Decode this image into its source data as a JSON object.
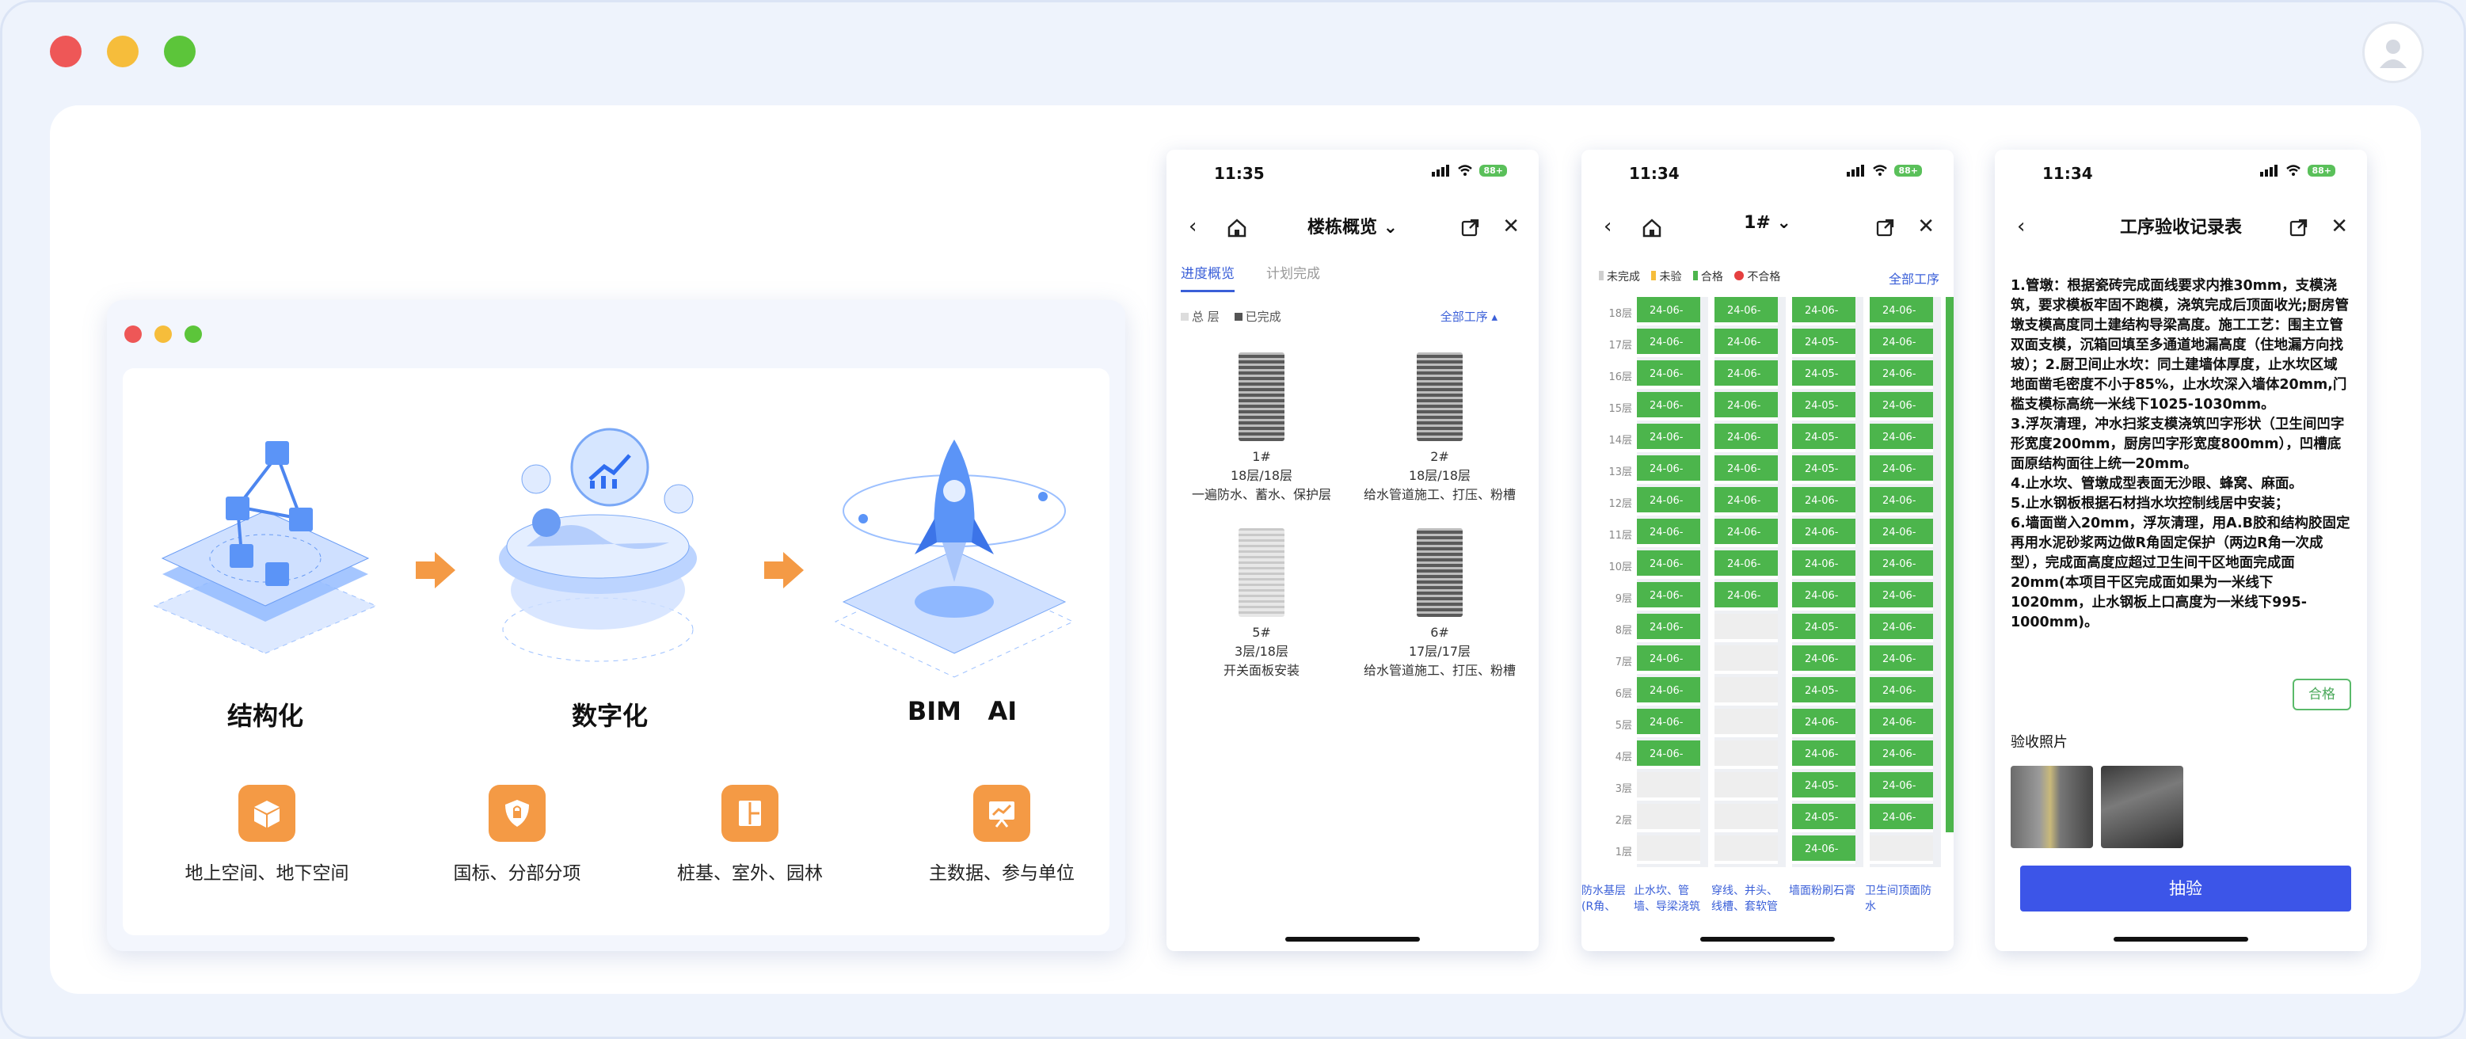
{
  "window": {
    "controls": {
      "close": "#ee5757",
      "minimize": "#f6bd3b",
      "maximize": "#5cc53a"
    },
    "avatar_icon": "user-icon"
  },
  "mock_window": {
    "stages": [
      {
        "title": "结构化",
        "icon": "network-cube-icon"
      },
      {
        "title": "数字化",
        "icon": "digital-chart-icon"
      },
      {
        "title": "BIM   AI",
        "icon": "rocket-icon"
      }
    ],
    "features": [
      {
        "label": "地上空间、地下空间",
        "icon": "box-icon"
      },
      {
        "label": "国标、分部分项",
        "icon": "shield-icon"
      },
      {
        "label": "桩基、室外、园林",
        "icon": "layout-icon"
      },
      {
        "label": "主数据、参与单位",
        "icon": "presentation-icon"
      }
    ],
    "accent": "#f49a45"
  },
  "phone1": {
    "time": "11:35",
    "battery": "88+",
    "title": "楼栋概览 ⌄",
    "tabs": [
      "进度概览",
      "计划完成"
    ],
    "legend": {
      "total": "总 层",
      "done": "已完成",
      "filter": "全部工序 ▴"
    },
    "buildings": [
      {
        "name": "1#",
        "floors": "18层/18层",
        "process": "一遍防水、蓄水、保护层"
      },
      {
        "name": "2#",
        "floors": "18层/18层",
        "process": "给水管道施工、打压、粉槽"
      },
      {
        "name": "5#",
        "floors": "3层/18层",
        "process": "开关面板安装"
      },
      {
        "name": "6#",
        "floors": "17层/17层",
        "process": "给水管道施工、打压、粉槽"
      }
    ]
  },
  "phone2": {
    "time": "11:34",
    "battery": "88+",
    "title": "1# ⌄",
    "legend": [
      "未完成",
      "未验",
      "合格",
      "不合格"
    ],
    "legend_colors": [
      "#cfcfcf",
      "#f6bd3b",
      "#4cb54c",
      "#e54040"
    ],
    "filter": "全部工序",
    "floors": [
      "18层",
      "17层",
      "16层",
      "15层",
      "14层",
      "13层",
      "12层",
      "11层",
      "10层",
      "9层",
      "8层",
      "7层",
      "6层",
      "5层",
      "4层",
      "3层",
      "2层",
      "1层"
    ],
    "columns": [
      {
        "label": "防水基层\n(R角、",
        "label2": "(R角、墙根)"
      },
      {
        "label": "止水坎、管",
        "label2": "墙、导梁浇筑"
      },
      {
        "label": "穿线、并头、",
        "label2": "线槽、套软管"
      },
      {
        "label": "墙面粉刷石膏",
        "label2": ""
      },
      {
        "label": "卫生间顶面防",
        "label2": "水"
      }
    ],
    "cells": {
      "c1": [
        "24-06-",
        "24-06-",
        "24-06-",
        "24-06-",
        "24-06-",
        "24-06-",
        "24-06-",
        "24-06-",
        "24-06-",
        "24-06-",
        "24-06-",
        "24-06-",
        "24-06-",
        "24-06-",
        "24-06-"
      ],
      "c2": [
        "24-06-",
        "24-06-",
        "24-06-",
        "24-06-",
        "24-06-",
        "24-06-",
        "24-06-",
        "24-06-",
        "24-06-",
        "24-06-"
      ],
      "c3": [
        "24-06-",
        "24-05-",
        "24-05-",
        "24-05-",
        "24-05-",
        "24-05-",
        "24-06-",
        "24-06-",
        "24-06-",
        "24-06-",
        "24-05-",
        "24-06-",
        "24-05-",
        "24-06-",
        "24-06-",
        "24-05-",
        "24-05-",
        "24-06-"
      ],
      "c4": [
        "24-06-",
        "24-06-",
        "24-06-",
        "24-06-",
        "24-06-",
        "24-06-",
        "24-06-",
        "24-06-",
        "24-06-",
        "24-06-",
        "24-06-",
        "24-06-",
        "24-06-",
        "24-06-",
        "24-06-",
        "24-06-",
        "24-06-"
      ]
    }
  },
  "phone3": {
    "time": "11:34",
    "battery": "88+",
    "title": "工序验收记录表",
    "text": "1.管墩：根据瓷砖完成面线要求内推30mm，支模浇筑，要求模板牢固不跑模，浇筑完成后顶面收光;厨房管墩支模高度同土建结构导梁高度。施工工艺：围主立管双面支模，沉箱回填至多通道地漏高度（住地漏方向找坡）；2.厨卫间止水坎：同土建墙体厚度，止水坎区域地面凿毛密度不小于85%，止水坎深入墙体20mm,门槛支模标高统一米线下1025-1030mm。\n3.浮灰清理，冲水扫浆支模浇筑凹字形状（卫生间凹字形宽度200mm，厨房凹字形宽度800mm），凹槽底面原结构面往上统一20mm。\n4.止水坎、管墩成型表面无沙眼、蜂窝、麻面。\n5.止水钢板根据石材挡水坎控制线居中安装；\n6.墙面凿入20mm，浮灰清理，用A.B胶和结构胶固定再用水泥砂浆两边做R角固定保护（两边R角一次成型），完成面高度应超过卫生间干区地面完成面20mm(本项目干区完成面如果为一米线下1020mm，止水钢板上口高度为一米线下995-1000mm)。",
    "pass_label": "合格",
    "photos_title": "验收照片",
    "button": "抽验"
  }
}
